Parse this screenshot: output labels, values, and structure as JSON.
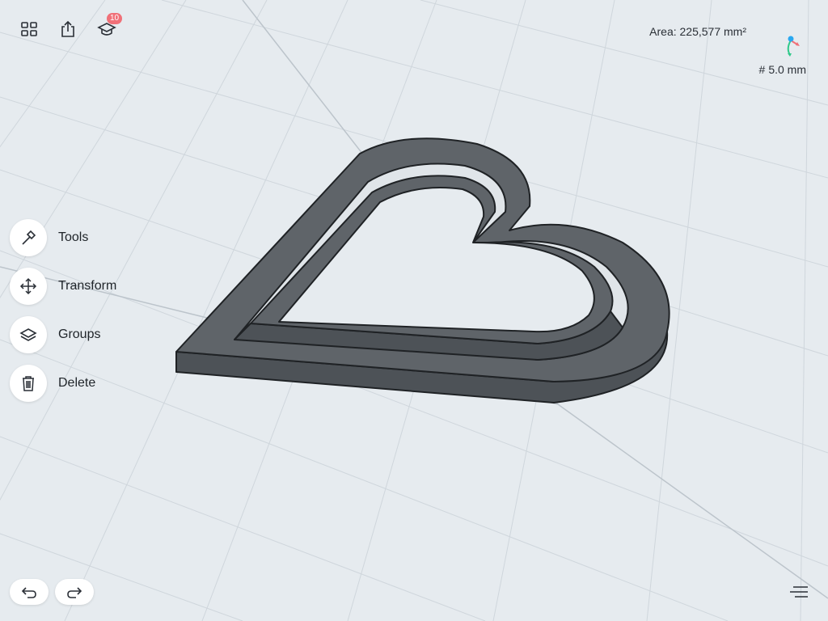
{
  "toolbar": {
    "gallery_icon": "grid-icon",
    "share_icon": "share-icon",
    "learn_icon": "graduation-cap-icon",
    "learn_badge": "10"
  },
  "status": {
    "area_label": "Area: 225,577 mm²",
    "grid_size": "5.0 mm",
    "grid_symbol": "#"
  },
  "side_tools": [
    {
      "label": "Tools",
      "icon": "hammer-icon"
    },
    {
      "label": "Transform",
      "icon": "move-arrows-icon"
    },
    {
      "label": "Groups",
      "icon": "layers-icon"
    },
    {
      "label": "Delete",
      "icon": "trash-icon"
    }
  ],
  "history": {
    "undo_icon": "undo-icon",
    "redo_icon": "redo-icon"
  },
  "menu_icon": "menu-lines-icon",
  "colors": {
    "canvas_bg": "#e6ebef",
    "grid_line": "#cfd6dc",
    "model_body": "#4d5257",
    "model_top": "#5f6469",
    "badge": "#f07078"
  }
}
